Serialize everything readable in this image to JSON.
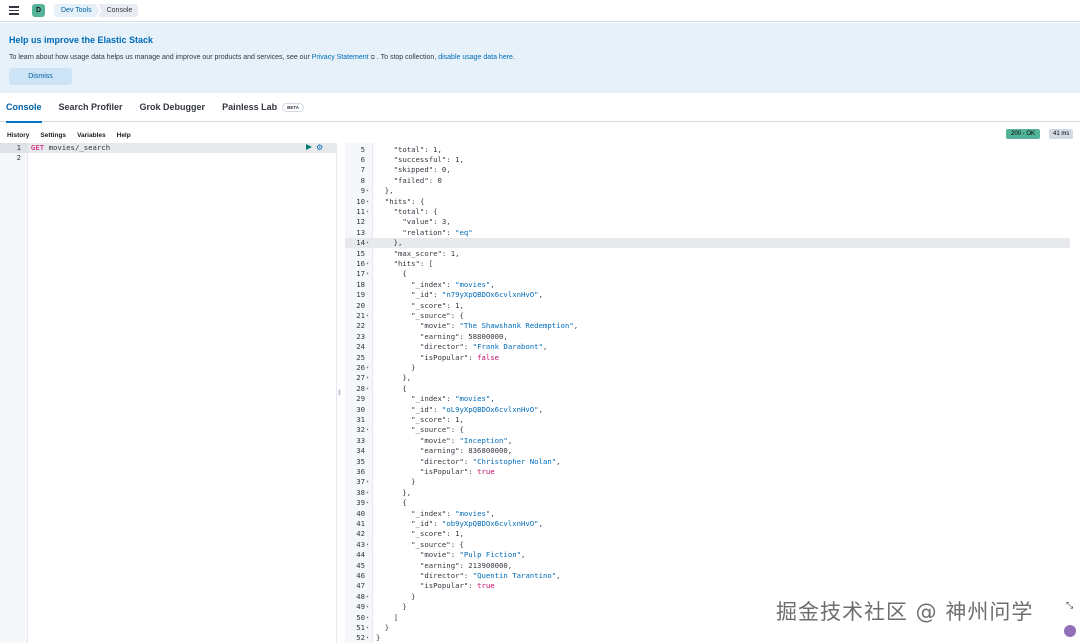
{
  "header": {
    "space_initial": "D",
    "breadcrumbs": [
      "Dev Tools",
      "Console"
    ]
  },
  "callout": {
    "title": "Help us improve the Elastic Stack",
    "body_prefix": "To learn about how usage data helps us manage and improve our products and services, see our ",
    "privacy_link": "Privacy Statement",
    "body_middle": ". To stop collection, ",
    "disable_link": "disable usage data here",
    "body_suffix": ".",
    "dismiss_label": "Dismiss"
  },
  "tabs": [
    {
      "label": "Console",
      "active": true
    },
    {
      "label": "Search Profiler"
    },
    {
      "label": "Grok Debugger"
    },
    {
      "label": "Painless Lab",
      "badge": "BETA"
    }
  ],
  "console_menu": [
    "History",
    "Settings",
    "Variables",
    "Help"
  ],
  "status": {
    "code": "200 - OK",
    "time": "41 ms"
  },
  "request": {
    "lines": [
      {
        "num": "1",
        "method": "GET",
        "url": " movies/_search"
      },
      {
        "num": "2",
        "method": "",
        "url": ""
      }
    ]
  },
  "response": {
    "active_line": "14",
    "lines": [
      {
        "num": "5",
        "fold": false,
        "text": "    \"total\": 1,"
      },
      {
        "num": "6",
        "fold": false,
        "text": "    \"successful\": 1,"
      },
      {
        "num": "7",
        "fold": false,
        "text": "    \"skipped\": 0,"
      },
      {
        "num": "8",
        "fold": false,
        "text": "    \"failed\": 0"
      },
      {
        "num": "9",
        "fold": true,
        "text": "  },"
      },
      {
        "num": "10",
        "fold": true,
        "text": "  \"hits\": {"
      },
      {
        "num": "11",
        "fold": true,
        "text": "    \"total\": {"
      },
      {
        "num": "12",
        "fold": false,
        "text": "      \"value\": 3,"
      },
      {
        "num": "13",
        "fold": false,
        "text": "      \"relation\": \"eq\""
      },
      {
        "num": "14",
        "fold": true,
        "text": "    },"
      },
      {
        "num": "15",
        "fold": false,
        "text": "    \"max_score\": 1,"
      },
      {
        "num": "16",
        "fold": true,
        "text": "    \"hits\": ["
      },
      {
        "num": "17",
        "fold": true,
        "text": "      {"
      },
      {
        "num": "18",
        "fold": false,
        "text": "        \"_index\": \"movies\","
      },
      {
        "num": "19",
        "fold": false,
        "text": "        \"_id\": \"n79yXpQBDOx6cvlxnHvO\","
      },
      {
        "num": "20",
        "fold": false,
        "text": "        \"_score\": 1,"
      },
      {
        "num": "21",
        "fold": true,
        "text": "        \"_source\": {"
      },
      {
        "num": "22",
        "fold": false,
        "text": "          \"movie\": \"The Shawshank Redemption\","
      },
      {
        "num": "23",
        "fold": false,
        "text": "          \"earning\": 58800000,"
      },
      {
        "num": "24",
        "fold": false,
        "text": "          \"director\": \"Frank Darabont\","
      },
      {
        "num": "25",
        "fold": false,
        "text": "          \"isPopular\": false"
      },
      {
        "num": "26",
        "fold": true,
        "text": "        }"
      },
      {
        "num": "27",
        "fold": true,
        "text": "      },"
      },
      {
        "num": "28",
        "fold": true,
        "text": "      {"
      },
      {
        "num": "29",
        "fold": false,
        "text": "        \"_index\": \"movies\","
      },
      {
        "num": "30",
        "fold": false,
        "text": "        \"_id\": \"oL9yXpQBDOx6cvlxnHvO\","
      },
      {
        "num": "31",
        "fold": false,
        "text": "        \"_score\": 1,"
      },
      {
        "num": "32",
        "fold": true,
        "text": "        \"_source\": {"
      },
      {
        "num": "33",
        "fold": false,
        "text": "          \"movie\": \"Inception\","
      },
      {
        "num": "34",
        "fold": false,
        "text": "          \"earning\": 836800000,"
      },
      {
        "num": "35",
        "fold": false,
        "text": "          \"director\": \"Christopher Nolan\","
      },
      {
        "num": "36",
        "fold": false,
        "text": "          \"isPopular\": true"
      },
      {
        "num": "37",
        "fold": true,
        "text": "        }"
      },
      {
        "num": "38",
        "fold": true,
        "text": "      },"
      },
      {
        "num": "39",
        "fold": true,
        "text": "      {"
      },
      {
        "num": "40",
        "fold": false,
        "text": "        \"_index\": \"movies\","
      },
      {
        "num": "41",
        "fold": false,
        "text": "        \"_id\": \"ob9yXpQBDOx6cvlxnHvO\","
      },
      {
        "num": "42",
        "fold": false,
        "text": "        \"_score\": 1,"
      },
      {
        "num": "43",
        "fold": true,
        "text": "        \"_source\": {"
      },
      {
        "num": "44",
        "fold": false,
        "text": "          \"movie\": \"Pulp Fiction\","
      },
      {
        "num": "45",
        "fold": false,
        "text": "          \"earning\": 213900000,"
      },
      {
        "num": "46",
        "fold": false,
        "text": "          \"director\": \"Quentin Tarantino\","
      },
      {
        "num": "47",
        "fold": false,
        "text": "          \"isPopular\": true"
      },
      {
        "num": "48",
        "fold": true,
        "text": "        }"
      },
      {
        "num": "49",
        "fold": true,
        "text": "      }"
      },
      {
        "num": "50",
        "fold": true,
        "text": "    ]"
      },
      {
        "num": "51",
        "fold": true,
        "text": "  }"
      },
      {
        "num": "52",
        "fold": true,
        "text": "}"
      }
    ]
  },
  "watermark": "掘金技术社区 @ 神州问学",
  "colors": {
    "accent": "#0077cc",
    "status_ok": "#54b399",
    "method": "#c80a68",
    "string": "#006bb8"
  }
}
